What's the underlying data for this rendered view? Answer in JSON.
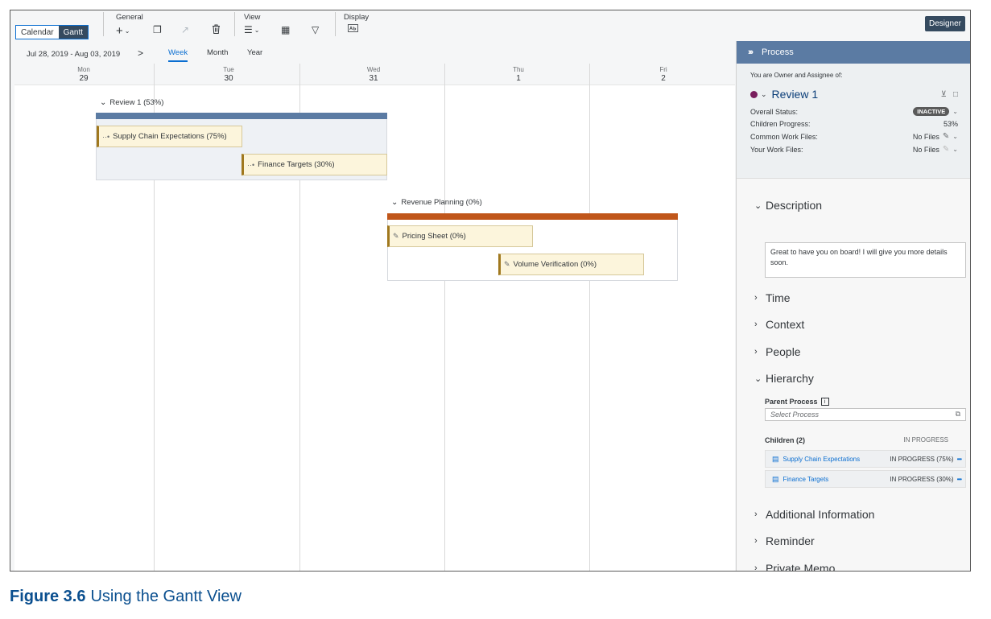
{
  "toolbar": {
    "mode_calendar": "Calendar",
    "mode_gantt": "Gantt",
    "groups": {
      "general": "General",
      "view": "View",
      "display": "Display"
    },
    "designer_label": "Designer"
  },
  "nav": {
    "date_range": "Jul 28, 2019 - Aug 03, 2019",
    "next": ">",
    "tabs": {
      "week": "Week",
      "month": "Month",
      "year": "Year"
    },
    "active_tab": "Week"
  },
  "days": [
    {
      "name": "Mon",
      "num": "29"
    },
    {
      "name": "Tue",
      "num": "30"
    },
    {
      "name": "Wed",
      "num": "31"
    },
    {
      "name": "Thu",
      "num": "1"
    },
    {
      "name": "Fri",
      "num": "2"
    }
  ],
  "gantt": {
    "group1": {
      "title": "Review 1 (53%)",
      "color": "#5b7ba3"
    },
    "group2": {
      "title": "Revenue Planning (0%)",
      "color": "#c0561a"
    },
    "tasks": {
      "t1": "Supply Chain Expectations (75%)",
      "t2": "Finance Targets (30%)",
      "t3": "Pricing Sheet (0%)",
      "t4": "Volume Verification (0%)"
    }
  },
  "panel": {
    "header": "Process",
    "owner_text": "You are Owner and Assignee of:",
    "process_name": "Review 1",
    "overall_status_label": "Overall Status:",
    "overall_status_value": "INACTIVE",
    "children_progress_label": "Children Progress:",
    "children_progress_value": "53%",
    "common_files_label": "Common Work Files:",
    "common_files_value": "No Files",
    "your_files_label": "Your Work Files:",
    "your_files_value": "No Files",
    "sections": {
      "description": "Description",
      "time": "Time",
      "context": "Context",
      "people": "People",
      "hierarchy": "Hierarchy",
      "additional": "Additional Information",
      "reminder": "Reminder",
      "memo": "Private Memo"
    },
    "description_text": "Great to have you on board! I will give you more details soon.",
    "parent_process_label": "Parent Process",
    "parent_process_placeholder": "Select Process",
    "children_label": "Children (2)",
    "children_status": "IN PROGRESS",
    "children": [
      {
        "name": "Supply Chain Expectations",
        "status": "IN PROGRESS (75%)"
      },
      {
        "name": "Finance Targets",
        "status": "IN PROGRESS (30%)"
      }
    ]
  },
  "caption": {
    "number": "Figure 3.6",
    "text": "Using the Gantt View"
  }
}
